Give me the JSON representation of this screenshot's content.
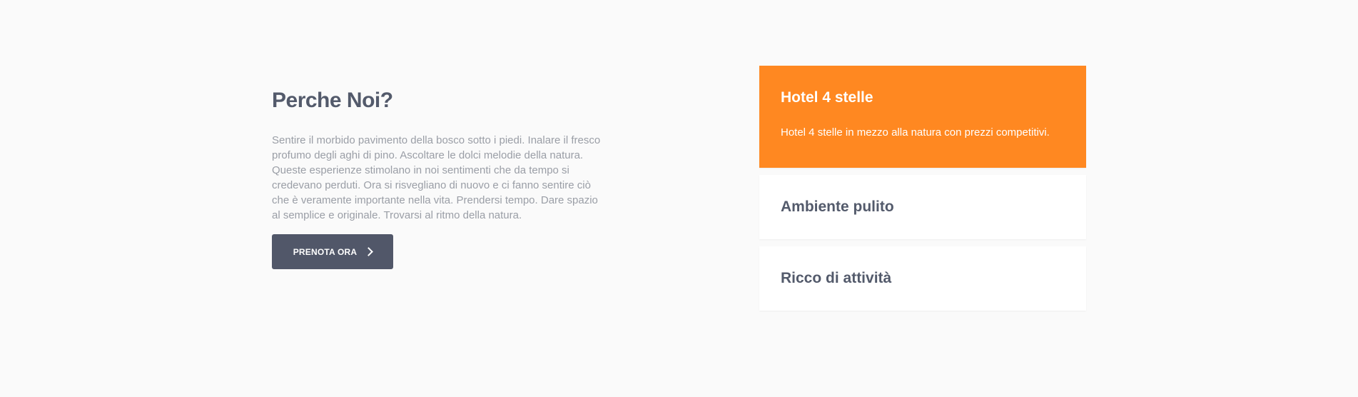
{
  "about": {
    "title": "Perche Noi?",
    "description": "Sentire il morbido pavimento della bosco sotto i piedi. Inalare il fresco profumo degli aghi di pino. Ascoltare le dolci melodie della natura. Queste esperienze stimolano in noi sentimenti che da tempo si credevano perduti. Ora si risvegliano di nuovo e ci fanno sentire ciò che è veramente importante nella vita. Prendersi tempo. Dare spazio al semplice e originale. Trovarsi al ritmo della natura.",
    "button_label": "PRENOTA ORA",
    "button_icon": "chevron-right-icon"
  },
  "features": [
    {
      "title": "Hotel 4 stelle",
      "text": "Hotel 4 stelle in mezzo alla natura con prezzi competitivi.",
      "active": true
    },
    {
      "title": "Ambiente pulito",
      "active": false
    },
    {
      "title": "Ricco di attività",
      "active": false
    }
  ],
  "colors": {
    "accent": "#ff8821",
    "dark": "#515769",
    "heading": "#535a6b",
    "text": "#9a9ea6",
    "background": "#fafafa"
  }
}
